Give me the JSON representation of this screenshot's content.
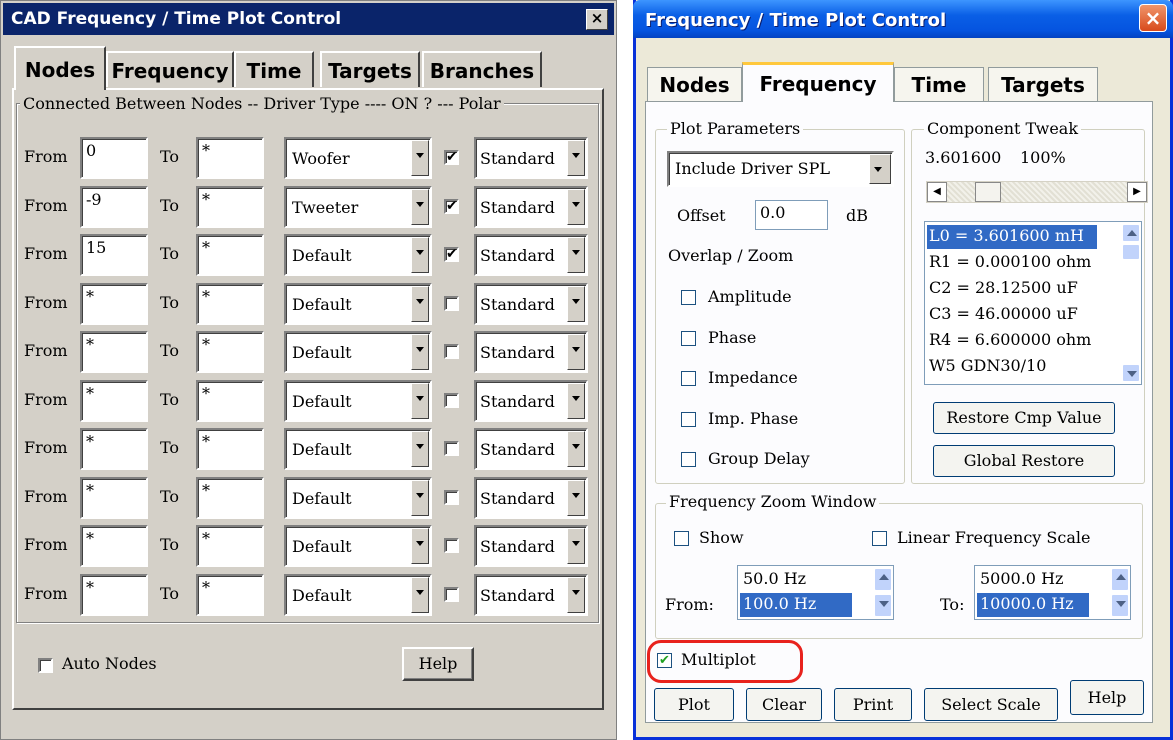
{
  "left_window": {
    "title": "CAD Frequency / Time Plot Control",
    "close_glyph": "×",
    "tabs": [
      "Nodes",
      "Frequency",
      "Time",
      "Targets",
      "Branches"
    ],
    "active_tab": "Nodes",
    "group_title": "Connected Between Nodes -- Driver Type ---- ON ? --- Polar",
    "from_label": "From",
    "to_label": "To",
    "rows": [
      {
        "from": "0",
        "to": "*",
        "driver": "Woofer",
        "on": true,
        "polar": "Standard"
      },
      {
        "from": "-9",
        "to": "*",
        "driver": "Tweeter",
        "on": true,
        "polar": "Standard"
      },
      {
        "from": "15",
        "to": "*",
        "driver": "Default",
        "on": true,
        "polar": "Standard"
      },
      {
        "from": "*",
        "to": "*",
        "driver": "Default",
        "on": false,
        "polar": "Standard"
      },
      {
        "from": "*",
        "to": "*",
        "driver": "Default",
        "on": false,
        "polar": "Standard"
      },
      {
        "from": "*",
        "to": "*",
        "driver": "Default",
        "on": false,
        "polar": "Standard"
      },
      {
        "from": "*",
        "to": "*",
        "driver": "Default",
        "on": false,
        "polar": "Standard"
      },
      {
        "from": "*",
        "to": "*",
        "driver": "Default",
        "on": false,
        "polar": "Standard"
      },
      {
        "from": "*",
        "to": "*",
        "driver": "Default",
        "on": false,
        "polar": "Standard"
      },
      {
        "from": "*",
        "to": "*",
        "driver": "Default",
        "on": false,
        "polar": "Standard"
      }
    ],
    "auto_nodes_label": "Auto Nodes",
    "auto_nodes_checked": false,
    "help_label": "Help"
  },
  "right_window": {
    "title": "Frequency / Time Plot Control",
    "close_glyph": "×",
    "tabs": [
      "Nodes",
      "Frequency",
      "Time",
      "Targets"
    ],
    "active_tab": "Frequency",
    "plot_parameters": {
      "title": "Plot Parameters",
      "mode": "Include Driver SPL",
      "offset_label": "Offset",
      "offset_value": "0.0",
      "offset_unit": "dB",
      "overlap_title": "Overlap / Zoom",
      "options": [
        {
          "label": "Amplitude",
          "checked": false
        },
        {
          "label": "Phase",
          "checked": false
        },
        {
          "label": "Impedance",
          "checked": false
        },
        {
          "label": "Imp. Phase",
          "checked": false
        },
        {
          "label": "Group Delay",
          "checked": false
        }
      ]
    },
    "component_tweak": {
      "title": "Component Tweak",
      "value_text": "3.601600",
      "percent_text": "100%",
      "slider_position": 0.18,
      "components": [
        "L0 = 3.601600 mH",
        "R1 = 0.000100 ohm",
        "C2 = 28.12500 uF",
        "C3 = 46.00000 uF",
        "R4 = 6.600000 ohm",
        "W5 GDN30/10"
      ],
      "selected_index": 0,
      "restore_label": "Restore Cmp Value",
      "global_restore_label": "Global Restore"
    },
    "zoom_window": {
      "title": "Frequency Zoom Window",
      "show_label": "Show",
      "show_checked": false,
      "linear_label": "Linear Frequency Scale",
      "linear_checked": false,
      "from_label": "From:",
      "from_options": [
        "50.0 Hz",
        "100.0 Hz"
      ],
      "from_selected": 1,
      "to_label": "To:",
      "to_options": [
        "5000.0 Hz",
        "10000.0 Hz"
      ],
      "to_selected": 1
    },
    "multiplot_label": "Multiplot",
    "multiplot_checked": true,
    "highlight_color": "#e8221d",
    "buttons": {
      "plot": "Plot",
      "clear": "Clear",
      "print": "Print",
      "select_scale": "Select Scale",
      "help": "Help"
    },
    "selection_color": "#316ac5"
  }
}
